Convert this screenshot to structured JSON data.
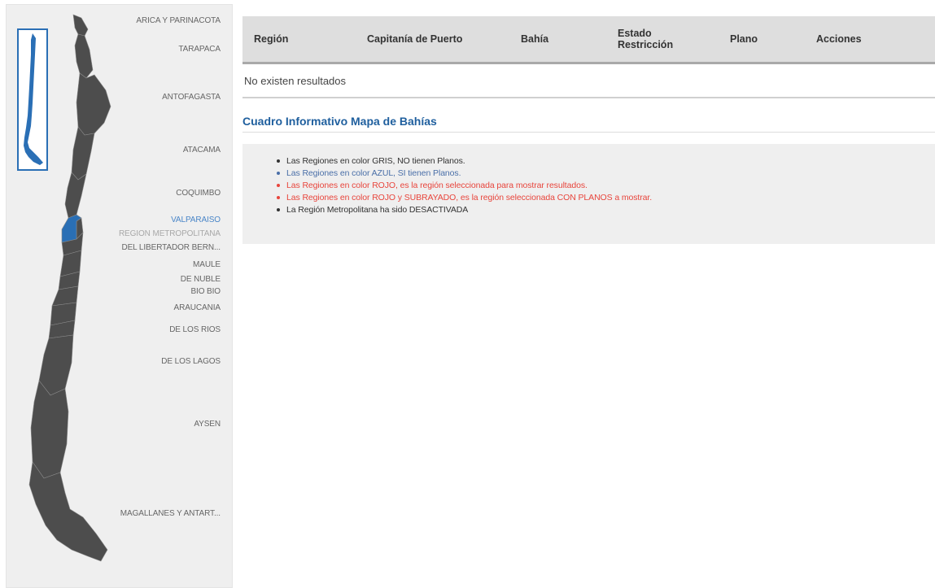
{
  "colors": {
    "region_gray": "#4d4d4d",
    "region_blue": "#2a6fb5",
    "selected_label": "#4a86c8",
    "info_title": "#1f5f9e",
    "text_red": "#e8453c",
    "text_blue": "#4a6fa8"
  },
  "map": {
    "regions": [
      {
        "label": "ARICA Y PARINACOTA",
        "state": "normal"
      },
      {
        "label": "TARAPACA",
        "state": "normal"
      },
      {
        "label": "ANTOFAGASTA",
        "state": "normal"
      },
      {
        "label": "ATACAMA",
        "state": "normal"
      },
      {
        "label": "COQUIMBO",
        "state": "normal"
      },
      {
        "label": "VALPARAISO",
        "state": "selected"
      },
      {
        "label": "REGION METROPOLITANA",
        "state": "disabled"
      },
      {
        "label": "DEL LIBERTADOR BERN...",
        "state": "normal"
      },
      {
        "label": "MAULE",
        "state": "normal"
      },
      {
        "label": "DE NUBLE",
        "state": "normal"
      },
      {
        "label": "BIO BIO",
        "state": "normal"
      },
      {
        "label": "ARAUCANIA",
        "state": "normal"
      },
      {
        "label": "DE LOS RIOS",
        "state": "normal"
      },
      {
        "label": "DE LOS LAGOS",
        "state": "normal"
      },
      {
        "label": "AYSEN",
        "state": "normal"
      },
      {
        "label": "MAGALLANES Y ANTART...",
        "state": "normal"
      }
    ]
  },
  "table": {
    "headers": {
      "region": "Región",
      "capitania": "Capitanía de Puerto",
      "bahia": "Bahía",
      "estado_line1": "Estado",
      "estado_line2": "Restricción",
      "plano": "Plano",
      "acciones": "Acciones"
    },
    "empty_message": "No existen resultados"
  },
  "info": {
    "title": "Cuadro Informativo Mapa de Bahías",
    "items": [
      {
        "text": "Las Regiones en color GRIS, NO tienen Planos.",
        "color": "#333333"
      },
      {
        "text": "Las Regiones en color AZUL, SI tienen Planos.",
        "color": "#4a6fa8"
      },
      {
        "text": "Las Regiones en color ROJO, es la región seleccionada para mostrar resultados.",
        "color": "#e8453c"
      },
      {
        "text": "Las Regiones en color ROJO y SUBRAYADO, es la región seleccionada CON PLANOS a mostrar.",
        "color": "#e8453c"
      },
      {
        "text": "La Región Metropolitana ha sido DESACTIVADA",
        "color": "#333333"
      }
    ]
  }
}
